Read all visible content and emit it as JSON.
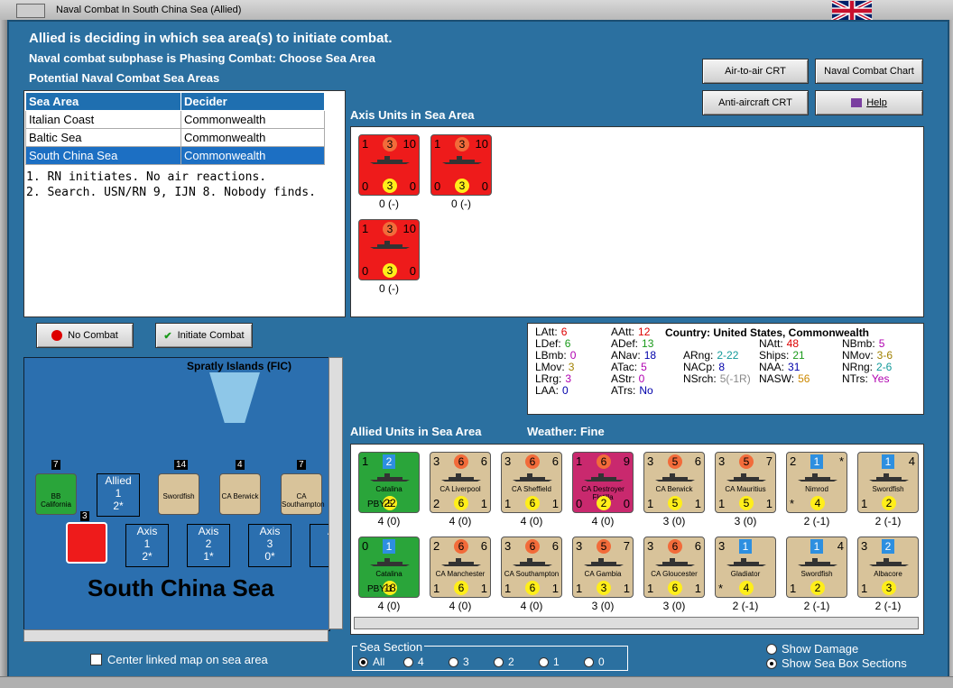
{
  "window": {
    "title": "Naval Combat In South China Sea (Allied)"
  },
  "header": {
    "line1": "Allied is deciding in which sea area(s) to initiate combat.",
    "line2": "Naval combat subphase is Phasing Combat: Choose Sea Area",
    "line3": "Potential Naval Combat Sea Areas"
  },
  "buttons": {
    "air_crt": "Air-to-air CRT",
    "naval_chart": "Naval Combat Chart",
    "aa_crt": "Anti-aircraft CRT",
    "help": "Help",
    "no_combat": "No Combat",
    "initiate": "Initiate Combat"
  },
  "sea_table": {
    "headers": [
      "Sea Area",
      "Decider"
    ],
    "rows": [
      {
        "area": "Italian Coast",
        "decider": "Commonwealth"
      },
      {
        "area": "Baltic Sea",
        "decider": "Commonwealth"
      },
      {
        "area": "South China Sea",
        "decider": "Commonwealth"
      }
    ]
  },
  "results": [
    "1. RN initiates.  No air reactions.",
    "2. Search. USN/RN 9, IJN 8.  Nobody finds."
  ],
  "axis_units": {
    "label": "Axis Units in Sea Area",
    "units": [
      {
        "tl": "1",
        "att": "3",
        "tr": "10",
        "bl": "0",
        "def": "3",
        "br": "0",
        "cap": "0 (-)"
      },
      {
        "tl": "1",
        "att": "3",
        "tr": "10",
        "bl": "0",
        "def": "3",
        "br": "0",
        "cap": "0 (-)"
      },
      {
        "tl": "1",
        "att": "3",
        "tr": "10",
        "bl": "0",
        "def": "3",
        "br": "0",
        "cap": "0 (-)"
      }
    ]
  },
  "stats": {
    "col1": [
      [
        "LAtt:",
        "6"
      ],
      [
        "LDef:",
        "6"
      ],
      [
        "LBmb:",
        "0"
      ],
      [
        "LMov:",
        "3"
      ],
      [
        "LRrg:",
        "3"
      ],
      [
        "LAA:",
        "0"
      ]
    ],
    "col2": [
      [
        "AAtt:",
        "12"
      ],
      [
        "ADef:",
        "13"
      ],
      [
        "ANav:",
        "18"
      ],
      [
        "ATac:",
        "5"
      ],
      [
        "AStr:",
        "0"
      ],
      [
        "ATrs:",
        "No"
      ]
    ],
    "country": "Country: United States, Commonwealth",
    "col3": [
      [
        "ARng:",
        "2-22"
      ],
      [
        "NACp:",
        "8"
      ],
      [
        "NSrch:",
        "5(-1R)"
      ]
    ],
    "col4": [
      [
        "NAtt:",
        "48"
      ],
      [
        "Ships:",
        "21"
      ],
      [
        "NAA:",
        "31"
      ],
      [
        "NASW:",
        "56"
      ]
    ],
    "col5": [
      [
        "NBmb:",
        "5"
      ],
      [
        "NMov:",
        "3-6"
      ],
      [
        "NRng:",
        "2-6"
      ],
      [
        "NTrs:",
        "Yes"
      ]
    ]
  },
  "allied": {
    "label": "Allied Units in Sea Area",
    "weather": "Weather:  Fine",
    "row1": [
      {
        "type": "green",
        "tl": "1",
        "name": "Catalina",
        "att": "2",
        "def": "22",
        "bl": "",
        "br": "",
        "sub": "PBY-5",
        "cap": "4 (0)"
      },
      {
        "type": "tan",
        "tl": "3",
        "att": "6",
        "tr": "6",
        "bl": "2",
        "def": "6",
        "br": "1",
        "name": "CA Liverpool",
        "cap": "4 (0)"
      },
      {
        "type": "tan",
        "tl": "3",
        "att": "6",
        "tr": "6",
        "bl": "1",
        "def": "6",
        "br": "1",
        "name": "CA Sheffield",
        "cap": "4 (0)"
      },
      {
        "type": "pink",
        "tl": "1",
        "att": "6",
        "tr": "9",
        "bl": "0",
        "def": "2",
        "br": "0",
        "name": "CA Destroyer Flotilla",
        "cap": "4 (0)"
      },
      {
        "type": "tan",
        "tl": "3",
        "att": "5",
        "tr": "6",
        "bl": "1",
        "def": "5",
        "br": "1",
        "name": "CA Berwick",
        "cap": "3 (0)"
      },
      {
        "type": "tan",
        "tl": "3",
        "att": "5",
        "tr": "7",
        "bl": "1",
        "def": "5",
        "br": "1",
        "name": "CA Mauritius",
        "cap": "3 (0)"
      },
      {
        "type": "tan",
        "tl": "2",
        "att": "1",
        "tr": "*",
        "bl": "*",
        "def": "4",
        "br": "",
        "name": "Nimrod",
        "cap": "2 (-1)"
      },
      {
        "type": "tan",
        "tl": "",
        "att": "1",
        "tr": "4",
        "bl": "1",
        "def": "2",
        "br": "",
        "name": "Swordfish",
        "cap": "2 (-1)"
      }
    ],
    "row2": [
      {
        "type": "green",
        "tl": "0",
        "name": "Catalina",
        "att": "1",
        "def": "18",
        "bl": "",
        "br": "",
        "sub": "PBY-1",
        "cap": "4 (0)"
      },
      {
        "type": "tan",
        "tl": "2",
        "att": "6",
        "tr": "6",
        "bl": "1",
        "def": "6",
        "br": "1",
        "name": "CA Manchester",
        "cap": "4 (0)"
      },
      {
        "type": "tan",
        "tl": "3",
        "att": "6",
        "tr": "6",
        "bl": "1",
        "def": "6",
        "br": "1",
        "name": "CA Southampton",
        "cap": "4 (0)"
      },
      {
        "type": "tan",
        "tl": "3",
        "att": "5",
        "tr": "7",
        "bl": "1",
        "def": "3",
        "br": "1",
        "name": "CA Gambia",
        "cap": "3 (0)"
      },
      {
        "type": "tan",
        "tl": "3",
        "att": "6",
        "tr": "6",
        "bl": "1",
        "def": "6",
        "br": "1",
        "name": "CA Gloucester",
        "cap": "3 (0)"
      },
      {
        "type": "tan",
        "tl": "3",
        "att": "1",
        "tr": "",
        "bl": "*",
        "def": "4",
        "br": "",
        "name": "Gladiator",
        "cap": "2 (-1)"
      },
      {
        "type": "tan",
        "tl": "",
        "att": "1",
        "tr": "4",
        "bl": "1",
        "def": "2",
        "br": "",
        "name": "Swordfish",
        "cap": "2 (-1)"
      },
      {
        "type": "tan",
        "tl": "3",
        "att": "2",
        "tr": "",
        "bl": "1",
        "def": "3",
        "br": "",
        "name": "Albacore",
        "cap": "2 (-1)"
      }
    ]
  },
  "map": {
    "island": "Spratly Islands (FIC)",
    "sea_name": "South China Sea",
    "allied_box": {
      "label": "Allied",
      "num": "1",
      "sub": "2*"
    },
    "axis_boxes": [
      {
        "label": "Axis",
        "num": "1",
        "sub": "2*"
      },
      {
        "label": "Axis",
        "num": "2",
        "sub": "1*"
      },
      {
        "label": "Axis",
        "num": "3",
        "sub": "0*"
      },
      {
        "label": "A",
        "num": "",
        "sub": ""
      }
    ],
    "stack_counts": [
      "7",
      "14",
      "4",
      "7",
      "3"
    ],
    "map_units": [
      "BB California",
      "Swordfish",
      "CA Berwick",
      "CA Southampton"
    ]
  },
  "bottom": {
    "center_map": "Center linked map on sea area",
    "sea_section": "Sea Section",
    "options": [
      "All",
      "4",
      "3",
      "2",
      "1",
      "0"
    ],
    "show_damage": "Show Damage",
    "show_box": "Show Sea Box Sections"
  },
  "colors": {
    "bg": "#2b70a0",
    "axis_red": "#ee1b1b",
    "allied_tan": "#d8c39a",
    "green": "#2aa53a"
  }
}
